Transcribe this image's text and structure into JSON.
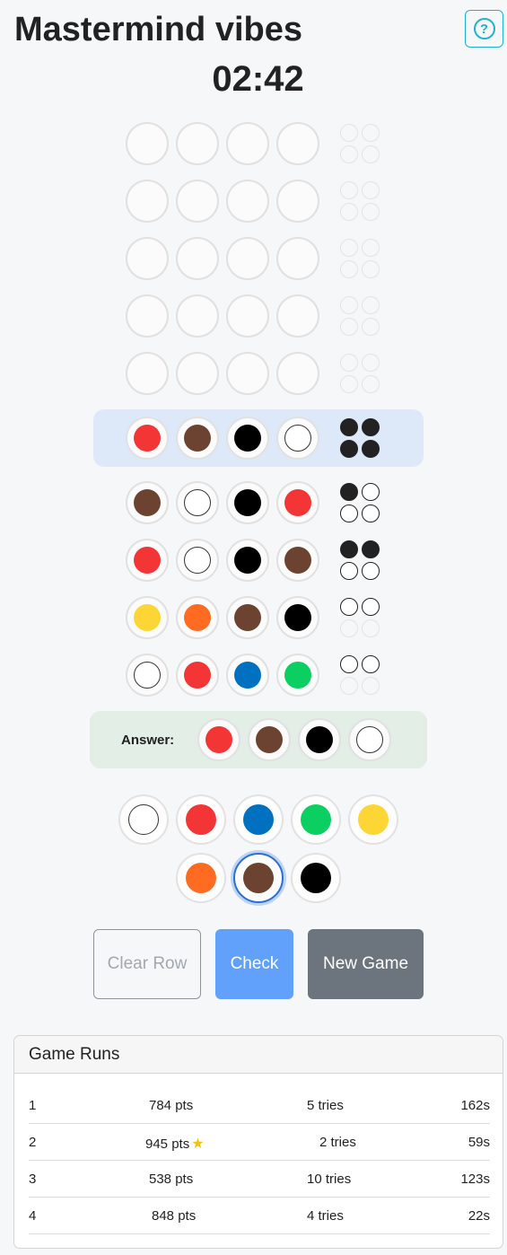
{
  "header": {
    "title": "Mastermind vibes",
    "help_icon": "?"
  },
  "timer": "02:42",
  "colors": {
    "white": "#ffffff",
    "red": "#f43535",
    "brown": "#6b4330",
    "black": "#000000",
    "yellow": "#fdd535",
    "orange": "#ff6b21",
    "blue": "#0070c0",
    "green": "#0ccf61",
    "highlight": "#dde8f8",
    "answer_bg": "#e2eee6"
  },
  "board": {
    "active_row": 5,
    "rows": [
      {
        "pegs": [
          null,
          null,
          null,
          null
        ],
        "feedback": [
          "empty",
          "empty",
          "empty",
          "empty"
        ]
      },
      {
        "pegs": [
          null,
          null,
          null,
          null
        ],
        "feedback": [
          "empty",
          "empty",
          "empty",
          "empty"
        ]
      },
      {
        "pegs": [
          null,
          null,
          null,
          null
        ],
        "feedback": [
          "empty",
          "empty",
          "empty",
          "empty"
        ]
      },
      {
        "pegs": [
          null,
          null,
          null,
          null
        ],
        "feedback": [
          "empty",
          "empty",
          "empty",
          "empty"
        ]
      },
      {
        "pegs": [
          null,
          null,
          null,
          null
        ],
        "feedback": [
          "empty",
          "empty",
          "empty",
          "empty"
        ]
      },
      {
        "pegs": [
          "red",
          "brown",
          "black",
          "white"
        ],
        "feedback": [
          "black",
          "black",
          "black",
          "black"
        ]
      },
      {
        "pegs": [
          "brown",
          "white",
          "black",
          "red"
        ],
        "feedback": [
          "black",
          "white",
          "white",
          "white"
        ]
      },
      {
        "pegs": [
          "red",
          "white",
          "black",
          "brown"
        ],
        "feedback": [
          "black",
          "black",
          "white",
          "white"
        ]
      },
      {
        "pegs": [
          "yellow",
          "orange",
          "brown",
          "black"
        ],
        "feedback": [
          "white",
          "white",
          "empty",
          "empty"
        ]
      },
      {
        "pegs": [
          "white",
          "red",
          "blue",
          "green"
        ],
        "feedback": [
          "white",
          "white",
          "empty",
          "empty"
        ]
      }
    ]
  },
  "answer": {
    "label": "Answer:",
    "pegs": [
      "red",
      "brown",
      "black",
      "white"
    ]
  },
  "palette": {
    "selected": "brown",
    "row1": [
      "white",
      "red",
      "blue",
      "green",
      "yellow"
    ],
    "row2": [
      "orange",
      "brown",
      "black"
    ]
  },
  "buttons": {
    "clear": "Clear Row",
    "check": "Check",
    "new_game": "New Game"
  },
  "runs": {
    "title": "Game Runs",
    "rows": [
      {
        "index": "1",
        "points": "784 pts",
        "star": false,
        "tries": "5 tries",
        "time": "162s"
      },
      {
        "index": "2",
        "points": "945 pts",
        "star": true,
        "tries": "2 tries",
        "time": "59s"
      },
      {
        "index": "3",
        "points": "538 pts",
        "star": false,
        "tries": "10 tries",
        "time": "123s"
      },
      {
        "index": "4",
        "points": "848 pts",
        "star": false,
        "tries": "4 tries",
        "time": "22s"
      }
    ]
  }
}
